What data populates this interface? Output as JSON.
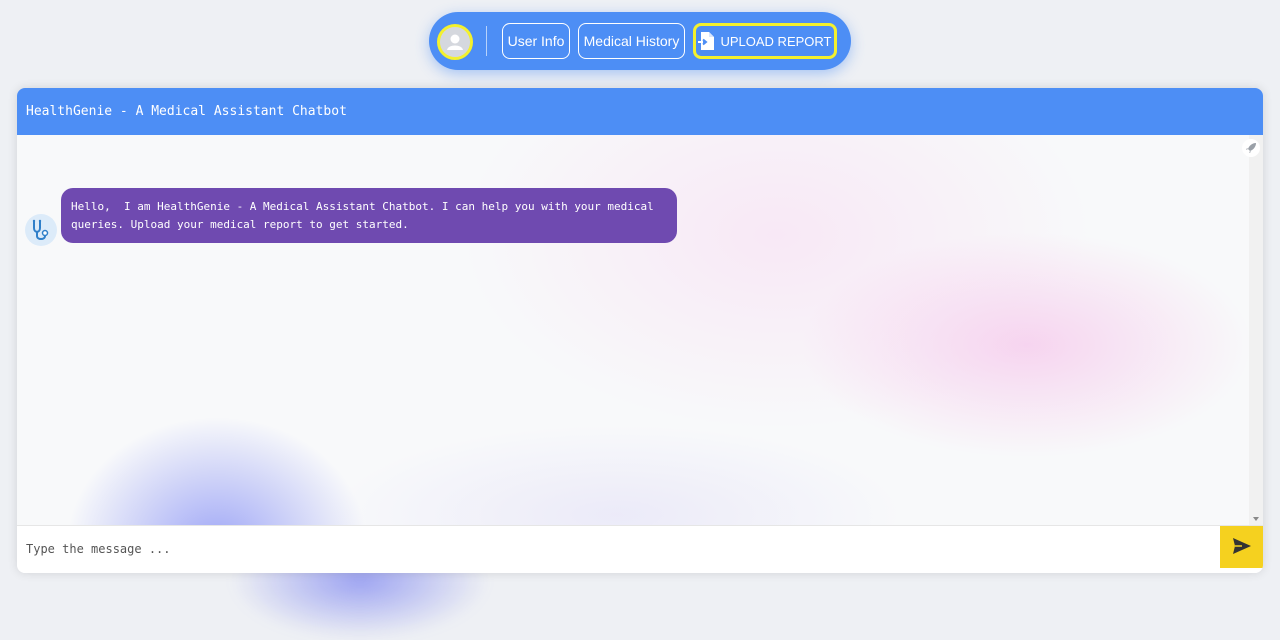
{
  "nav": {
    "user_info_label": "User Info",
    "medical_history_label": "Medical History",
    "upload_report_label": "UPLOAD REPORT"
  },
  "chat": {
    "title": "HealthGenie - A Medical Assistant Chatbot",
    "messages": [
      {
        "sender": "bot",
        "text": "Hello,  I am HealthGenie - A Medical Assistant Chatbot. I can help you with your medical\nqueries. Upload your medical report to get started."
      }
    ],
    "input_placeholder": "Type the message ..."
  },
  "icons": {
    "avatar": "user-avatar-icon",
    "upload": "file-upload-icon",
    "send": "send-icon",
    "bot": "stethoscope-icon",
    "rocket": "rocket-icon"
  },
  "colors": {
    "primary": "#4d8ef5",
    "highlight": "#f3f12e",
    "bot_bubble": "#6f4ab0",
    "send_button": "#f5d11f"
  }
}
